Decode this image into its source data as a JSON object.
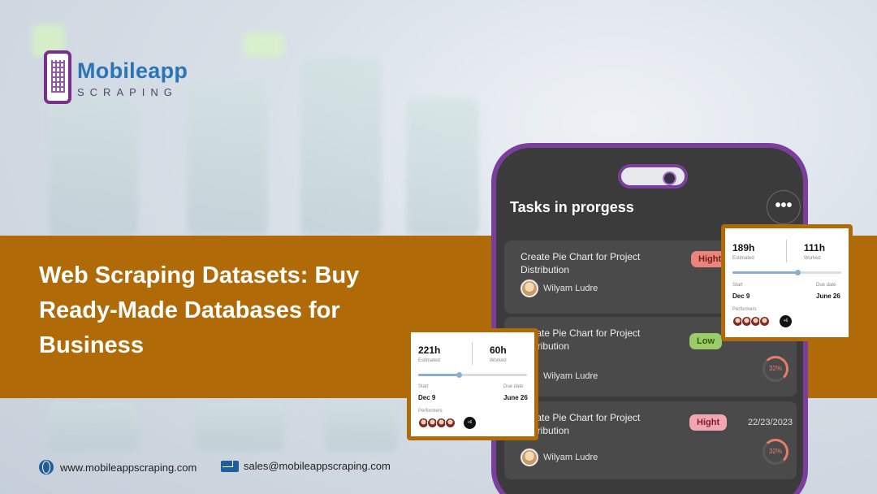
{
  "brand": {
    "name": "Mobileapp",
    "tagline": "SCRAPING"
  },
  "headline": "Web Scraping Datasets: Buy Ready-Made Databases for Business",
  "phone": {
    "title": "Tasks in prorgess",
    "more_icon": "more-dots-icon",
    "tasks": [
      {
        "title": "Create Pie Chart for Project Distribution",
        "priority": "Hight",
        "assignee": "Wilyam Ludre",
        "progress": "",
        "date": ""
      },
      {
        "title": "Create Pie Chart for Project Distribution",
        "priority": "Low",
        "assignee": "Wilyam Ludre",
        "progress": "32%",
        "date": ""
      },
      {
        "title": "Create Pie Chart for Project Distribution",
        "priority": "Hight",
        "assignee": "Wilyam Ludre",
        "progress": "32%",
        "date": "22/23/2023"
      }
    ]
  },
  "cards": [
    {
      "estimated": "189h",
      "estimated_label": "Estimated",
      "worked": "111h",
      "worked_label": "Worked",
      "progress": 0.6,
      "start_label": "Start",
      "start": "Dec 9",
      "due_label": "Due date",
      "due": "June 26",
      "performers_label": "Performers",
      "more": "+6"
    },
    {
      "estimated": "221h",
      "estimated_label": "Estimated",
      "worked": "60h",
      "worked_label": "Worked",
      "progress": 0.37,
      "start_label": "Start",
      "start": "Dec 9",
      "due_label": "Due date",
      "due": "June 26",
      "performers_label": "Performers",
      "more": "+6"
    }
  ],
  "footer": {
    "website": "www.mobileappscraping.com",
    "email": "sales@mobileappscraping.com"
  },
  "colors": {
    "band": "#b06a08",
    "phone_frame": "#7a3f9c",
    "high": "#e9857c",
    "low": "#9ccc67",
    "high2": "#f0a7b2"
  }
}
